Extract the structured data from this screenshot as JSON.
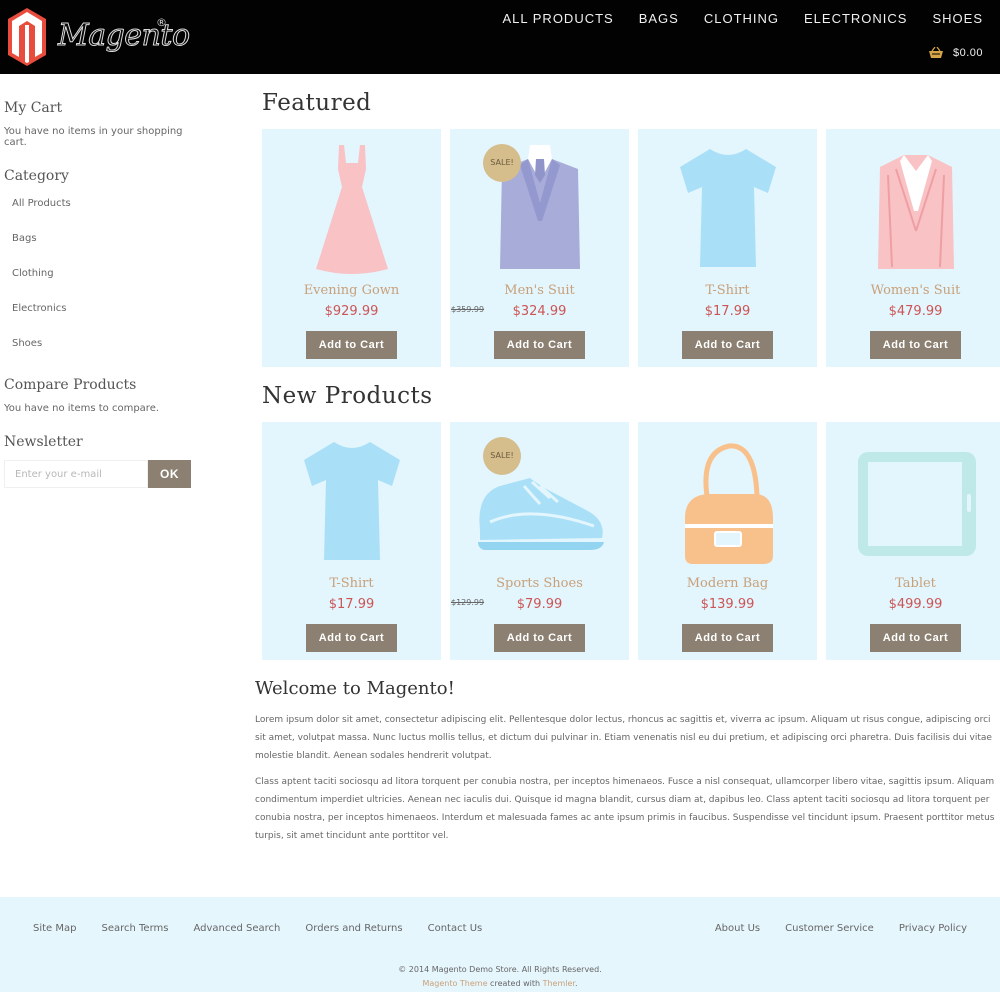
{
  "header": {
    "logo_text": "Magento",
    "logo_reg": "®",
    "nav": [
      "ALL PRODUCTS",
      "BAGS",
      "CLOTHING",
      "ELECTRONICS",
      "SHOES"
    ],
    "cart_total": "$0.00"
  },
  "sidebar": {
    "cart_title": "My Cart",
    "cart_text": "You have no items in your shopping cart.",
    "category_title": "Category",
    "categories": [
      "All Products",
      "Bags",
      "Clothing",
      "Electronics",
      "Shoes"
    ],
    "compare_title": "Compare Products",
    "compare_text": "You have no items to compare.",
    "newsletter_title": "Newsletter",
    "newsletter_placeholder": "Enter your e-mail",
    "newsletter_button": "OK"
  },
  "featured": {
    "title": "Featured",
    "products": [
      {
        "name": "Evening Gown",
        "price": "$929.99",
        "old_price": "",
        "sale": "",
        "button": "Add to Cart",
        "icon": "dress-icon"
      },
      {
        "name": "Men's Suit",
        "price": "$324.99",
        "old_price": "$359.99",
        "sale": "SALE!",
        "button": "Add to Cart",
        "icon": "mens-suit-icon"
      },
      {
        "name": "T-Shirt",
        "price": "$17.99",
        "old_price": "",
        "sale": "",
        "button": "Add to Cart",
        "icon": "tshirt-icon"
      },
      {
        "name": "Women's Suit",
        "price": "$479.99",
        "old_price": "",
        "sale": "",
        "button": "Add to Cart",
        "icon": "womens-suit-icon"
      }
    ]
  },
  "new_products": {
    "title": "New Products",
    "products": [
      {
        "name": "T-Shirt",
        "price": "$17.99",
        "old_price": "",
        "sale": "",
        "button": "Add to Cart",
        "icon": "tshirt-icon"
      },
      {
        "name": "Sports Shoes",
        "price": "$79.99",
        "old_price": "$129.99",
        "sale": "SALE!",
        "button": "Add to Cart",
        "icon": "shoe-icon"
      },
      {
        "name": "Modern Bag",
        "price": "$139.99",
        "old_price": "",
        "sale": "",
        "button": "Add to Cart",
        "icon": "bag-icon"
      },
      {
        "name": "Tablet",
        "price": "$499.99",
        "old_price": "",
        "sale": "",
        "button": "Add to Cart",
        "icon": "tablet-icon"
      }
    ]
  },
  "welcome": {
    "title": "Welcome to Magento!",
    "p1": "Lorem ipsum dolor sit amet, consectetur adipiscing elit. Pellentesque dolor lectus, rhoncus ac sagittis et, viverra ac ipsum. Aliquam ut risus congue, adipiscing orci sit amet, volutpat massa. Nunc luctus mollis tellus, et dictum dui pulvinar in. Etiam venenatis nisl eu dui pretium, et adipiscing orci pharetra. Duis facilisis dui vitae molestie blandit. Aenean sodales hendrerit volutpat.",
    "p2": "Class aptent taciti sociosqu ad litora torquent per conubia nostra, per inceptos himenaeos. Fusce a nisl consequat, ullamcorper libero vitae, sagittis ipsum. Aliquam condimentum imperdiet ultricies. Aenean nec iaculis dui. Quisque id magna blandit, cursus diam at, dapibus leo. Class aptent taciti sociosqu ad litora torquent per conubia nostra, per inceptos himenaeos. Interdum et malesuada fames ac ante ipsum primis in faucibus. Suspendisse vel tincidunt ipsum. Praesent porttitor metus turpis, sit amet tincidunt ante porttitor vel."
  },
  "footer": {
    "links_left": [
      "Site Map",
      "Search Terms",
      "Advanced Search",
      "Orders and Returns",
      "Contact Us"
    ],
    "links_right": [
      "About Us",
      "Customer Service",
      "Privacy Policy"
    ],
    "copyright": "© 2014 Magento Demo Store. All Rights Reserved.",
    "credit_theme": "Magento Theme",
    "credit_mid": " created with ",
    "credit_author": "Themler",
    "credit_end": "."
  },
  "colors": {
    "header_bg": "#020202",
    "card_bg": "#e3f5fd",
    "button_bg": "#8b8071",
    "product_name": "#c8a17a",
    "price": "#cc5555",
    "sale_badge": "#d5bd8c",
    "footer_bg": "#e6f6fd"
  }
}
